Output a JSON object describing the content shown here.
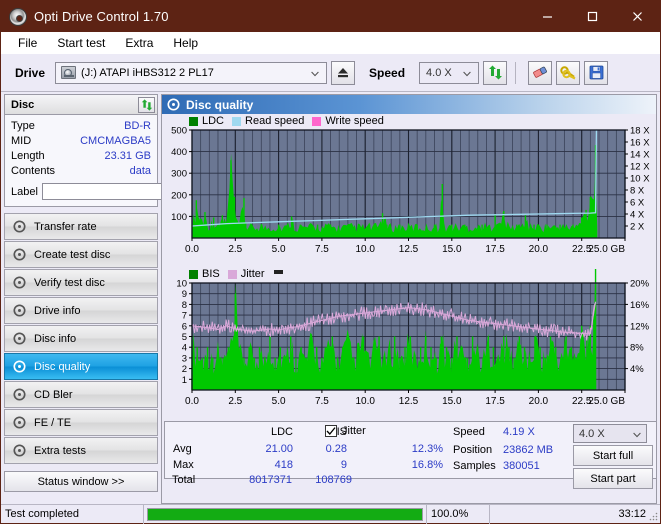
{
  "window": {
    "title": "Opti Drive Control 1.70",
    "icon": "disc-icon",
    "minimize": "–",
    "maximize": "□",
    "close": "✕"
  },
  "menu": {
    "items": [
      "File",
      "Start test",
      "Extra",
      "Help"
    ]
  },
  "toolbar": {
    "drive_label": "Drive",
    "drive_value": "(J:)   ATAPI iHBS312  2 PL17",
    "eject_icon": "eject-icon",
    "speed_label": "Speed",
    "speed_value": "4.0 X",
    "refresh_icon": "refresh-icon",
    "erase_icon": "eraser-icon",
    "bypass_icon": "keys-icon",
    "save_icon": "floppy-save-icon"
  },
  "disc": {
    "header": "Disc",
    "refresh_icon": "refresh-icon",
    "rows": [
      {
        "key": "Type",
        "value": "BD-R"
      },
      {
        "key": "MID",
        "value": "CMCMAGBA5"
      },
      {
        "key": "Length",
        "value": "23.31 GB"
      },
      {
        "key": "Contents",
        "value": "data"
      }
    ],
    "label_key": "Label",
    "label_value": "",
    "label_placeholder": "",
    "disc_icon": "cd-icon"
  },
  "nav": {
    "items": [
      {
        "label": "Transfer rate",
        "icon": "disc-icon",
        "active": false
      },
      {
        "label": "Create test disc",
        "icon": "disc-icon",
        "active": false
      },
      {
        "label": "Verify test disc",
        "icon": "disc-icon",
        "active": false
      },
      {
        "label": "Drive info",
        "icon": "disc-icon",
        "active": false
      },
      {
        "label": "Disc info",
        "icon": "disc-icon",
        "active": false
      },
      {
        "label": "Disc quality",
        "icon": "disc-icon",
        "active": true
      },
      {
        "label": "CD Bler",
        "icon": "disc-icon",
        "active": false
      },
      {
        "label": "FE / TE",
        "icon": "disc-icon",
        "active": false
      },
      {
        "label": "Extra tests",
        "icon": "disc-icon",
        "active": false
      }
    ],
    "status_window": "Status window >>"
  },
  "panel": {
    "title": "Disc quality",
    "icon": "disc-icon"
  },
  "stats": {
    "col_ldc": "LDC",
    "col_bis": "BIS",
    "jitter_label": "Jitter",
    "jitter_checked": true,
    "rows": [
      {
        "name": "Avg",
        "ldc": "21.00",
        "bis": "0.28",
        "jitter": "12.3%"
      },
      {
        "name": "Max",
        "ldc": "418",
        "bis": "9",
        "jitter": "16.8%"
      },
      {
        "name": "Total",
        "ldc": "8017371",
        "bis": "108769",
        "jitter": ""
      }
    ],
    "speed_label": "Speed",
    "speed_value": "4.19 X",
    "position_label": "Position",
    "position_value": "23862 MB",
    "samples_label": "Samples",
    "samples_value": "380051",
    "speed_select": "4.0 X",
    "start_full": "Start full",
    "start_part": "Start part"
  },
  "statusbar": {
    "message": "Test completed",
    "percent_text": "100.0%",
    "percent_value": 100,
    "elapsed": "33:12"
  },
  "colors": {
    "title_bg": "#5d2314",
    "accent_blue": "#2c3cc6",
    "ldc_green": "#00a000",
    "bis_green": "#00a000",
    "read_speed": "#9fd9f0",
    "write_speed": "#ff66cc",
    "jitter_pink": "#d9a8d9",
    "plot_bg": "#6b7793",
    "progress_green": "#13ac13"
  },
  "chart_data": [
    {
      "type": "line",
      "id": "ldc-chart",
      "title": "",
      "xlabel": "GB",
      "ylabel": "",
      "xlim": [
        0,
        25.0
      ],
      "ylim": [
        0,
        500
      ],
      "y2lim": [
        0,
        18
      ],
      "y2label": "X",
      "grid": true,
      "legend_position": "top-left",
      "legend": [
        {
          "name": "LDC",
          "color": "#008000"
        },
        {
          "name": "Read speed",
          "color": "#9fd9f0"
        },
        {
          "name": "Write speed",
          "color": "#ff66cc"
        }
      ],
      "xticks": [
        "0.0",
        "2.5",
        "5.0",
        "7.5",
        "10.0",
        "12.5",
        "15.0",
        "17.5",
        "20.0",
        "22.5",
        "25.0 GB"
      ],
      "yticks": [
        "100",
        "200",
        "300",
        "400",
        "500"
      ],
      "y2ticks": [
        "2 X",
        "4 X",
        "6 X",
        "8 X",
        "10 X",
        "12 X",
        "14 X",
        "16 X",
        "18 X"
      ],
      "series": [
        {
          "name": "LDC",
          "color": "#00c800",
          "style": "bars",
          "x": [
            0.0,
            0.25,
            0.5,
            0.75,
            1.0,
            1.25,
            1.5,
            1.75,
            2.0,
            2.25,
            2.45,
            2.5,
            2.75,
            3.0,
            3.1,
            3.25,
            3.5,
            3.75,
            4.0,
            4.25,
            4.5,
            4.75,
            5.0,
            5.25,
            5.5,
            5.75,
            6.0,
            6.25,
            6.5,
            6.75,
            7.0,
            7.25,
            7.5,
            7.75,
            8.0,
            8.25,
            8.5,
            8.75,
            9.0,
            9.25,
            9.5,
            9.75,
            10.0,
            10.25,
            10.5,
            10.75,
            11.0,
            11.25,
            11.5,
            11.75,
            12.0,
            12.25,
            12.5,
            12.75,
            13.0,
            13.25,
            13.5,
            13.75,
            14.0,
            14.25,
            14.45,
            14.5,
            14.75,
            15.0,
            15.25,
            15.5,
            15.75,
            16.0,
            16.25,
            16.5,
            16.75,
            17.0,
            17.25,
            17.5,
            17.75,
            18.0,
            18.25,
            18.5,
            18.75,
            19.0,
            19.25,
            19.5,
            19.75,
            20.0,
            20.25,
            20.5,
            20.75,
            21.0,
            21.25,
            21.5,
            21.75,
            22.0,
            22.25,
            22.5,
            22.75,
            23.0,
            23.3,
            23.4
          ],
          "values": [
            50,
            175,
            90,
            120,
            60,
            95,
            55,
            105,
            75,
            360,
            190,
            80,
            70,
            185,
            70,
            60,
            55,
            60,
            65,
            55,
            60,
            58,
            62,
            55,
            60,
            100,
            58,
            62,
            55,
            60,
            58,
            62,
            55,
            60,
            62,
            55,
            58,
            60,
            56,
            62,
            58,
            60,
            56,
            62,
            58,
            60,
            115,
            62,
            58,
            60,
            62,
            56,
            60,
            58,
            62,
            56,
            60,
            58,
            62,
            56,
            250,
            60,
            58,
            62,
            60,
            56,
            62,
            58,
            60,
            58,
            62,
            60,
            58,
            110,
            62,
            125,
            60,
            58,
            62,
            60,
            105,
            58,
            62,
            60,
            58,
            62,
            60,
            58,
            62,
            60,
            58,
            62,
            60,
            95,
            130,
            190,
            430,
            0
          ]
        },
        {
          "name": "Read speed",
          "color": "#9fd9f0",
          "style": "line",
          "x": [
            0.0,
            1.0,
            2.0,
            3.0,
            4.0,
            5.0,
            6.0,
            7.0,
            8.0,
            9.0,
            10.0,
            11.0,
            12.0,
            13.0,
            14.0,
            15.0,
            16.0,
            17.0,
            18.0,
            19.0,
            20.0,
            21.0,
            22.0,
            23.0,
            23.3,
            23.35,
            23.4
          ],
          "values": [
            2.0,
            2.2,
            2.4,
            2.5,
            2.6,
            2.7,
            2.8,
            2.9,
            3.0,
            3.1,
            3.2,
            3.3,
            3.4,
            3.5,
            3.6,
            3.7,
            3.8,
            3.85,
            3.9,
            3.95,
            4.0,
            4.05,
            4.1,
            4.15,
            4.2,
            18.0,
            18.0
          ],
          "axis": "y2"
        },
        {
          "name": "Write speed",
          "color": "#ff66cc",
          "style": "line",
          "x": [],
          "values": [],
          "axis": "y2"
        }
      ]
    },
    {
      "type": "line",
      "id": "bis-jitter-chart",
      "title": "",
      "xlabel": "GB",
      "ylabel": "",
      "xlim": [
        0,
        25.0
      ],
      "ylim": [
        0,
        10
      ],
      "y2lim": [
        0,
        20
      ],
      "y2label": "%",
      "grid": true,
      "legend_position": "top-left",
      "legend": [
        {
          "name": "BIS",
          "color": "#008000"
        },
        {
          "name": "Jitter",
          "color": "#d9a8d9"
        }
      ],
      "xticks": [
        "0.0",
        "2.5",
        "5.0",
        "7.5",
        "10.0",
        "12.5",
        "15.0",
        "17.5",
        "20.0",
        "22.5",
        "25.0 GB"
      ],
      "yticks": [
        "1",
        "2",
        "3",
        "4",
        "5",
        "6",
        "7",
        "8",
        "9",
        "10"
      ],
      "y2ticks": [
        "4%",
        "8%",
        "12%",
        "16%",
        "20%"
      ],
      "series": [
        {
          "name": "BIS",
          "color": "#00c800",
          "style": "bars",
          "x": [
            0.0,
            0.3,
            0.6,
            0.9,
            1.2,
            1.5,
            1.8,
            2.1,
            2.4,
            2.5,
            2.7,
            3.0,
            3.3,
            3.6,
            3.9,
            4.2,
            4.5,
            4.8,
            5.1,
            5.4,
            5.7,
            6.0,
            6.3,
            6.6,
            6.9,
            7.2,
            7.5,
            7.8,
            8.1,
            8.4,
            8.7,
            9.0,
            9.3,
            9.6,
            9.9,
            10.2,
            10.5,
            10.8,
            11.1,
            11.4,
            11.7,
            12.0,
            12.3,
            12.6,
            12.9,
            13.2,
            13.5,
            13.8,
            14.1,
            14.4,
            14.7,
            15.0,
            15.3,
            15.6,
            15.9,
            16.2,
            16.5,
            16.8,
            17.1,
            17.4,
            17.7,
            18.0,
            18.3,
            18.6,
            18.9,
            19.2,
            19.5,
            19.8,
            20.1,
            20.4,
            20.7,
            21.0,
            21.3,
            21.6,
            21.9,
            22.2,
            22.5,
            22.8,
            23.0,
            23.2,
            23.3
          ],
          "values": [
            5,
            4,
            3,
            4,
            3,
            4,
            3,
            4,
            5,
            9,
            4,
            3,
            4,
            3,
            4,
            3,
            5,
            3,
            4,
            3,
            5,
            3,
            4,
            3,
            5,
            4,
            3,
            4,
            5,
            3,
            4,
            5,
            3,
            4,
            5,
            3,
            4,
            5,
            3,
            4,
            5,
            3,
            4,
            5,
            3,
            4,
            5,
            4,
            3,
            5,
            4,
            3,
            5,
            4,
            3,
            5,
            4,
            3,
            5,
            4,
            3,
            5,
            4,
            3,
            5,
            4,
            3,
            5,
            4,
            3,
            5,
            4,
            3,
            5,
            4,
            3,
            6,
            5,
            6,
            7,
            16
          ]
        },
        {
          "name": "Jitter",
          "color": "#d9a8d9",
          "style": "line",
          "axis": "y2",
          "x": [
            0.0,
            0.5,
            1.0,
            1.5,
            2.0,
            2.5,
            3.0,
            3.5,
            4.0,
            4.5,
            5.0,
            5.5,
            6.0,
            6.5,
            7.0,
            7.5,
            8.0,
            8.5,
            9.0,
            9.5,
            10.0,
            10.5,
            11.0,
            11.5,
            12.0,
            12.5,
            13.0,
            13.5,
            14.0,
            14.5,
            15.0,
            15.5,
            16.0,
            16.5,
            17.0,
            17.5,
            18.0,
            18.5,
            19.0,
            19.5,
            20.0,
            20.5,
            21.0,
            21.5,
            22.0,
            22.5,
            23.0,
            23.3
          ],
          "values": [
            12.0,
            11.8,
            11.6,
            11.3,
            12.0,
            11.4,
            11.2,
            11.0,
            11.2,
            11.4,
            11.2,
            11.6,
            11.8,
            12.2,
            12.6,
            13.0,
            13.4,
            13.8,
            14.0,
            14.2,
            14.4,
            14.6,
            14.8,
            15.0,
            15.2,
            15.4,
            15.2,
            15.0,
            14.6,
            14.2,
            13.8,
            13.4,
            13.0,
            12.8,
            12.6,
            12.4,
            12.2,
            12.0,
            11.8,
            11.6,
            11.4,
            11.2,
            11.0,
            10.8,
            10.7,
            10.6,
            10.5,
            16.5
          ]
        }
      ],
      "marker_icon": "dark-marker"
    }
  ]
}
